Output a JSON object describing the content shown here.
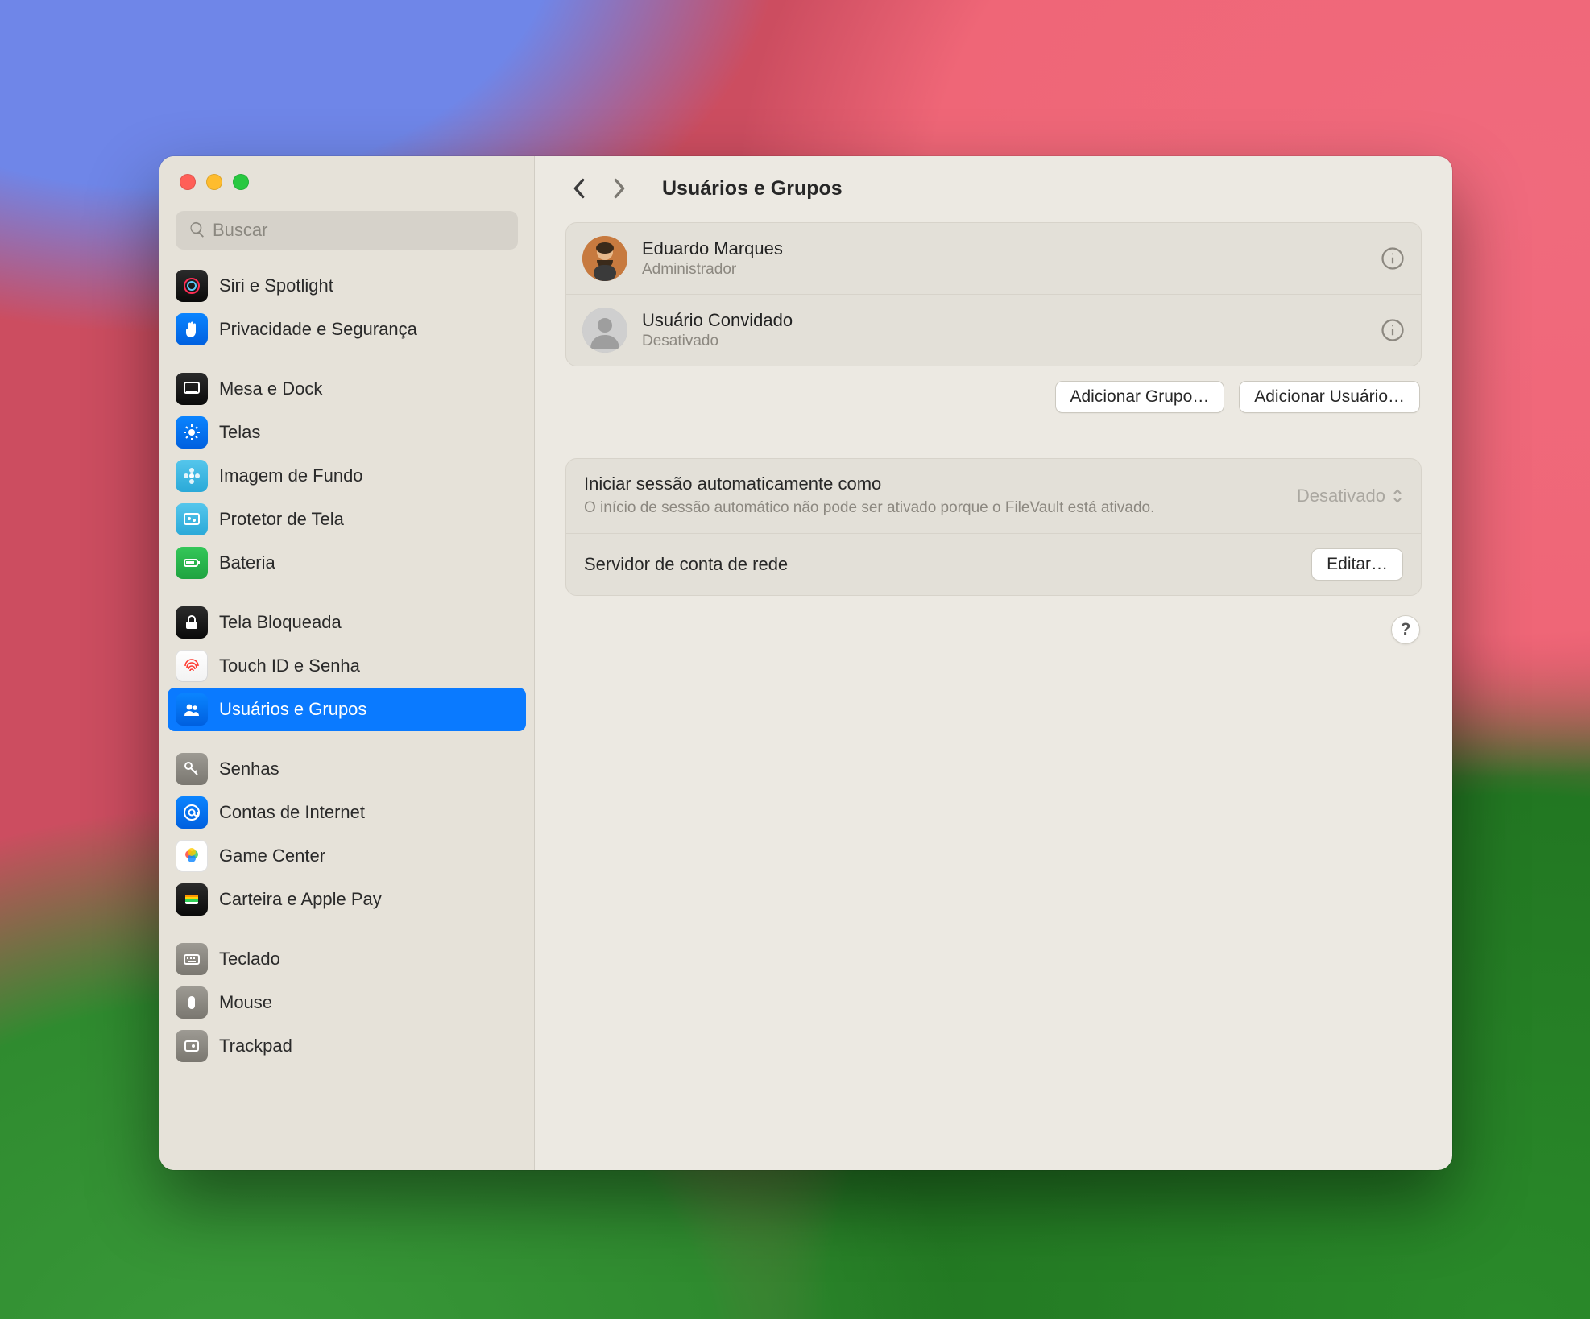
{
  "search": {
    "placeholder": "Buscar"
  },
  "header": {
    "title": "Usuários e Grupos"
  },
  "sidebar": {
    "groups": [
      [
        {
          "label": "Siri e Spotlight",
          "icon": "siri",
          "bg1": "#2b2b2b",
          "bg2": "#0a0a0a"
        },
        {
          "label": "Privacidade e Segurança",
          "icon": "hand",
          "bg1": "#0a84ff",
          "bg2": "#0060df"
        }
      ],
      [
        {
          "label": "Mesa e Dock",
          "icon": "dock",
          "bg1": "#2b2b2b",
          "bg2": "#0a0a0a"
        },
        {
          "label": "Telas",
          "icon": "sun",
          "bg1": "#0a84ff",
          "bg2": "#0060df"
        },
        {
          "label": "Imagem de Fundo",
          "icon": "flower",
          "bg1": "#55c6ec",
          "bg2": "#2aa9d8"
        },
        {
          "label": "Protetor de Tela",
          "icon": "screensaver",
          "bg1": "#55c6ec",
          "bg2": "#2aa9d8"
        },
        {
          "label": "Bateria",
          "icon": "battery",
          "bg1": "#34c759",
          "bg2": "#1fa340"
        }
      ],
      [
        {
          "label": "Tela Bloqueada",
          "icon": "lock",
          "bg1": "#2b2b2b",
          "bg2": "#0a0a0a"
        },
        {
          "label": "Touch ID e Senha",
          "icon": "fingerprint",
          "bg1": "#ffffff",
          "bg2": "#f2f2f2"
        },
        {
          "label": "Usuários e Grupos",
          "icon": "users",
          "bg1": "#0a84ff",
          "bg2": "#0060df",
          "selected": true
        }
      ],
      [
        {
          "label": "Senhas",
          "icon": "key",
          "bg1": "#9d9a93",
          "bg2": "#7a7770"
        },
        {
          "label": "Contas de Internet",
          "icon": "at",
          "bg1": "#0a84ff",
          "bg2": "#0060df"
        },
        {
          "label": "Game Center",
          "icon": "gamecenter",
          "bg1": "#ffffff",
          "bg2": "#ffffff"
        },
        {
          "label": "Carteira e Apple Pay",
          "icon": "wallet",
          "bg1": "#2b2b2b",
          "bg2": "#0a0a0a"
        }
      ],
      [
        {
          "label": "Teclado",
          "icon": "keyboard",
          "bg1": "#9d9a93",
          "bg2": "#7a7770"
        },
        {
          "label": "Mouse",
          "icon": "mouse",
          "bg1": "#9d9a93",
          "bg2": "#7a7770"
        },
        {
          "label": "Trackpad",
          "icon": "trackpad",
          "bg1": "#9d9a93",
          "bg2": "#7a7770"
        }
      ]
    ]
  },
  "users": [
    {
      "name": "Eduardo Marques",
      "role": "Administrador",
      "avatar": "person1"
    },
    {
      "name": "Usuário Convidado",
      "role": "Desativado",
      "avatar": "guest"
    }
  ],
  "buttons": {
    "add_group": "Adicionar Grupo…",
    "add_user": "Adicionar Usuário…",
    "edit": "Editar…",
    "help": "?"
  },
  "settings": {
    "autologin_label": "Iniciar sessão automaticamente como",
    "autologin_value": "Desativado",
    "autologin_note": "O início de sessão automático não pode ser ativado porque o FileVault está ativado.",
    "netaccount_label": "Servidor de conta de rede"
  }
}
